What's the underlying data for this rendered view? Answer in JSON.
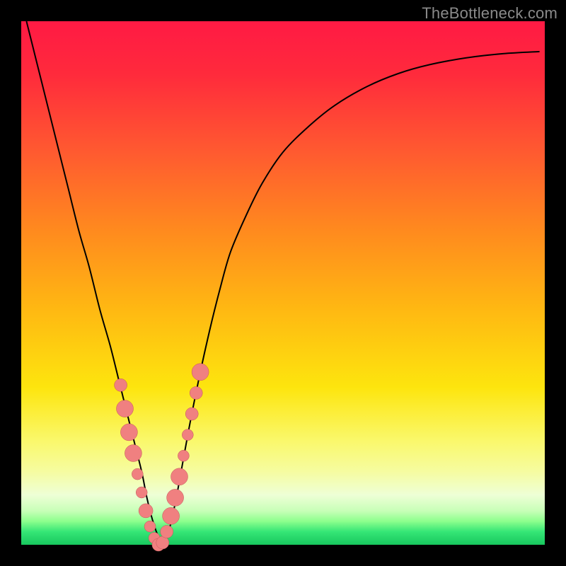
{
  "watermark": "TheBottleneck.com",
  "colors": {
    "frame": "#000000",
    "marker_fill": "#f08080",
    "marker_stroke": "#c05656",
    "curve": "#000000",
    "gradient_stops": [
      {
        "pos": 0.0,
        "color": "#ff1a44"
      },
      {
        "pos": 0.1,
        "color": "#ff2a3c"
      },
      {
        "pos": 0.25,
        "color": "#ff5a30"
      },
      {
        "pos": 0.4,
        "color": "#ff8a1e"
      },
      {
        "pos": 0.55,
        "color": "#ffb812"
      },
      {
        "pos": 0.7,
        "color": "#fde50e"
      },
      {
        "pos": 0.8,
        "color": "#faf86a"
      },
      {
        "pos": 0.86,
        "color": "#f6fca0"
      },
      {
        "pos": 0.905,
        "color": "#eeffd6"
      },
      {
        "pos": 0.935,
        "color": "#c8ffb8"
      },
      {
        "pos": 0.955,
        "color": "#8dff8d"
      },
      {
        "pos": 0.975,
        "color": "#35e676"
      },
      {
        "pos": 1.0,
        "color": "#18c85e"
      }
    ]
  },
  "chart_data": {
    "type": "line",
    "title": "",
    "xlabel": "",
    "ylabel": "",
    "xlim": [
      0,
      100
    ],
    "ylim": [
      0,
      100
    ],
    "grid": false,
    "series": [
      {
        "name": "bottleneck-curve",
        "x": [
          1,
          3,
          5,
          7,
          9,
          11,
          13,
          15,
          17,
          18.5,
          20,
          21.5,
          23,
          24,
          25,
          26,
          27,
          28,
          29,
          30,
          32,
          34,
          36,
          38,
          40,
          43,
          46,
          50,
          55,
          60,
          66,
          72,
          78,
          85,
          92,
          99
        ],
        "y": [
          100,
          92,
          84,
          76,
          68,
          60,
          53,
          45,
          38,
          32,
          26,
          20,
          14,
          9,
          5,
          2,
          0,
          2,
          6,
          11,
          22,
          32,
          41,
          49,
          56,
          63,
          69,
          75,
          80,
          84,
          87.5,
          90,
          91.7,
          93,
          93.8,
          94.2
        ]
      }
    ],
    "markers": {
      "name": "highlighted-range",
      "x": [
        19.0,
        19.8,
        20.6,
        21.4,
        22.2,
        23.0,
        23.8,
        24.6,
        25.4,
        26.2,
        27.0,
        27.8,
        28.6,
        29.4,
        30.2,
        31.0,
        31.8,
        32.6,
        33.4,
        34.2
      ],
      "y": [
        30.5,
        26.0,
        21.5,
        17.5,
        13.5,
        10.0,
        6.5,
        3.5,
        1.3,
        0.0,
        0.4,
        2.5,
        5.5,
        9.0,
        13.0,
        17.0,
        21.0,
        25.0,
        29.0,
        33.0
      ],
      "dotsize": [
        9,
        12,
        12,
        12,
        8,
        8,
        10,
        8,
        8,
        9,
        9,
        9,
        12,
        12,
        12,
        8,
        8,
        9,
        9,
        12
      ]
    }
  }
}
